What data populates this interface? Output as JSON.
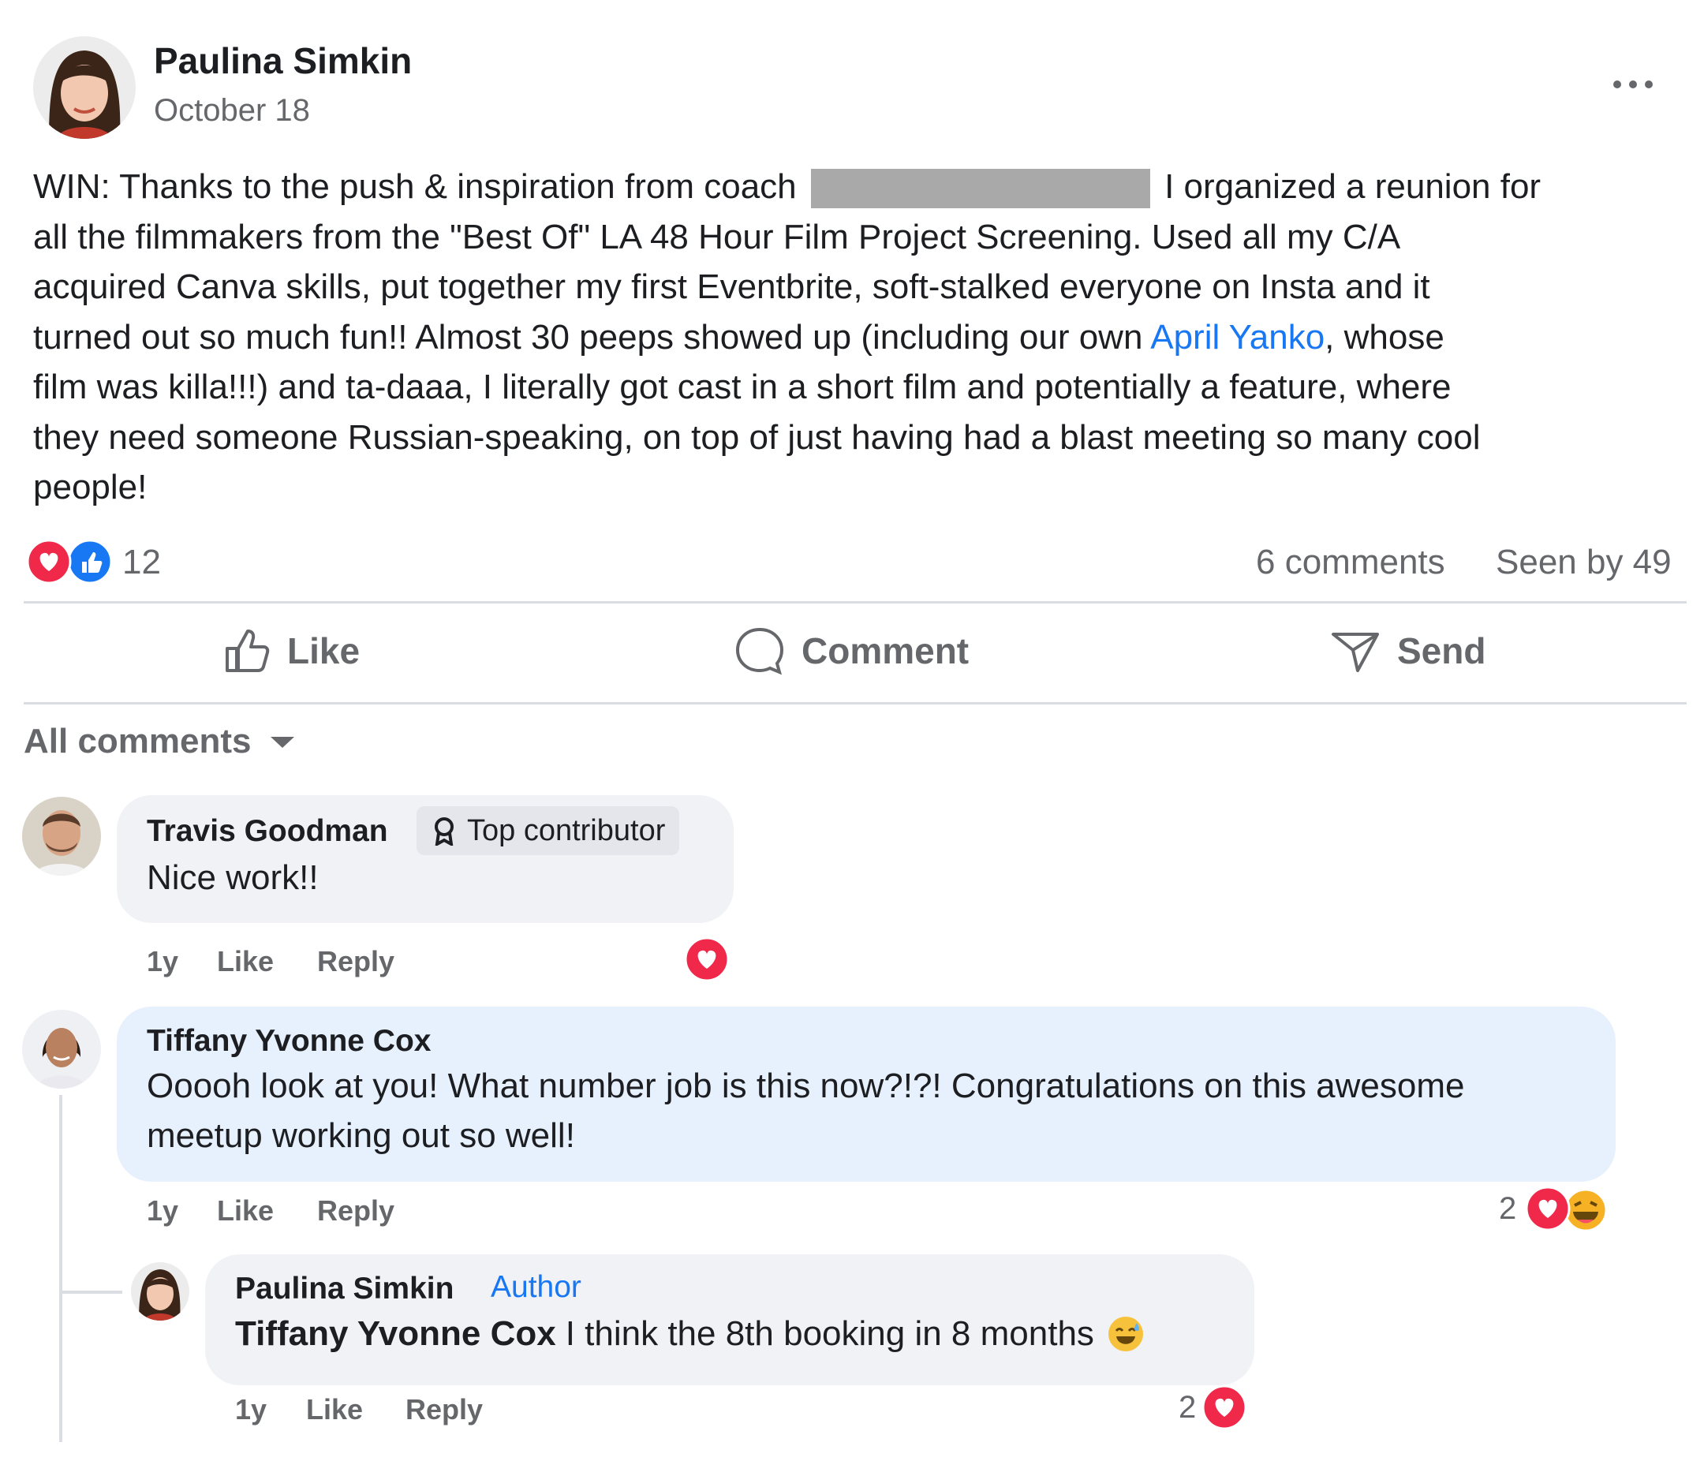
{
  "post": {
    "author_name": "Paulina Simkin",
    "date": "October 18",
    "more_icon": "more-horizontal-icon",
    "body": {
      "part1": "WIN: Thanks to the push & inspiration from coach",
      "part2": "I organized a reunion for",
      "line2": "all the filmmakers from the \"Best Of\" LA 48 Hour Film Project Screening. Used all my C/A",
      "line3": "acquired Canva skills, put together my first Eventbrite, soft-stalked everyone on Insta and it",
      "line4_a": "turned out so much fun!! Almost 30 peeps showed up (including our own",
      "mention": "April Yanko",
      "line4_b": ", whose",
      "line5": "film was killa!!!) and ta-daaa, I literally got cast in a short film and potentially a feature, where",
      "line6": "they need someone Russian-speaking, on top of just having had a blast meeting so many cool",
      "line7": "people!"
    },
    "reaction_count": "12",
    "comments_count": "6 comments",
    "seen_by": "Seen by 49",
    "actions": {
      "like": "Like",
      "comment": "Comment",
      "send": "Send"
    }
  },
  "comments_filter": {
    "label": "All comments"
  },
  "comments": [
    {
      "name": "Travis Goodman",
      "badge": "Top contributor",
      "text": "Nice work!!",
      "time": "1y",
      "like": "Like",
      "reply": "Reply"
    },
    {
      "name": "Tiffany Yvonne Cox",
      "text_line1": "Ooooh look at you! What number job is this now?!?! Congratulations on this awesome",
      "text_line2": "meetup working out so well!",
      "time": "1y",
      "like": "Like",
      "reply": "Reply",
      "reaction_count": "2"
    },
    {
      "name": "Paulina Simkin",
      "badge": "Author",
      "mention": "Tiffany Yvonne Cox",
      "text": "I think the 8th booking in 8 months",
      "time": "1y",
      "like": "Like",
      "reply": "Reply",
      "reaction_count": "2"
    }
  ],
  "colors": {
    "link": "#1877f2",
    "meta": "#65676b",
    "bubble_gray": "#f0f2f5",
    "bubble_blue": "#e7f0fd",
    "love_red": "#f02849",
    "like_blue": "#1877f2"
  }
}
